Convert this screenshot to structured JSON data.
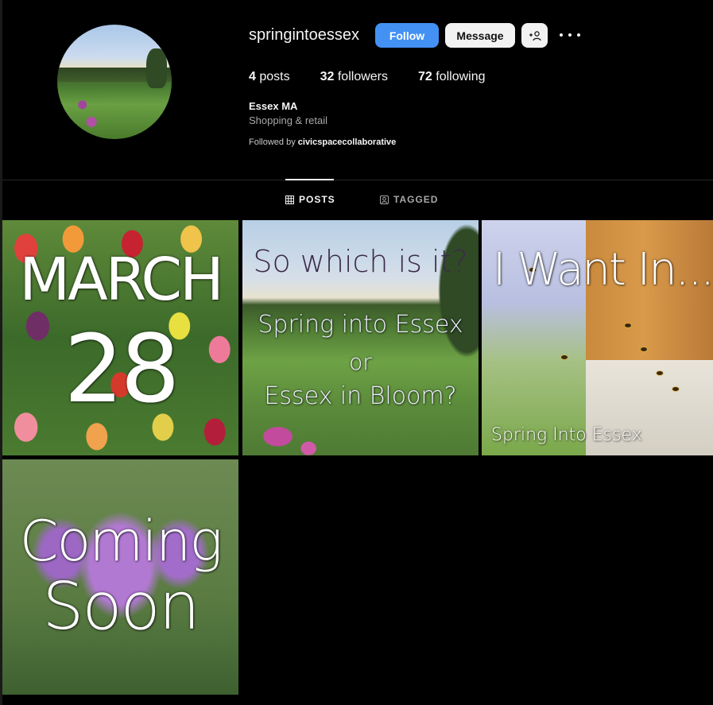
{
  "profile": {
    "username": "springintoessex",
    "follow_label": "Follow",
    "message_label": "Message",
    "suggest_label": "+὆4",
    "stats": {
      "posts_count": "4",
      "posts_label": "posts",
      "followers_count": "32",
      "followers_label": "followers",
      "following_count": "72",
      "following_label": "following"
    },
    "display_name": "Essex MA",
    "category": "Shopping & retail",
    "followed_by_prefix": "Followed by",
    "followed_by_user": "civicspacecollaborative"
  },
  "tabs": {
    "posts": "POSTS",
    "tagged": "TAGGED"
  },
  "posts": [
    {
      "lines": [
        "MARCH",
        "28"
      ]
    },
    {
      "lines": [
        "So which is it?",
        "Spring into Essex",
        "or",
        "Essex in Bloom?"
      ]
    },
    {
      "lines": [
        "I Want In...",
        "Spring Into Essex"
      ]
    },
    {
      "lines": [
        "Coming",
        "Soon"
      ]
    }
  ],
  "colors": {
    "background": "#000000",
    "follow_button": "#4391f3",
    "secondary_button": "#f2f2f2",
    "muted_text": "#a8a8a8"
  }
}
